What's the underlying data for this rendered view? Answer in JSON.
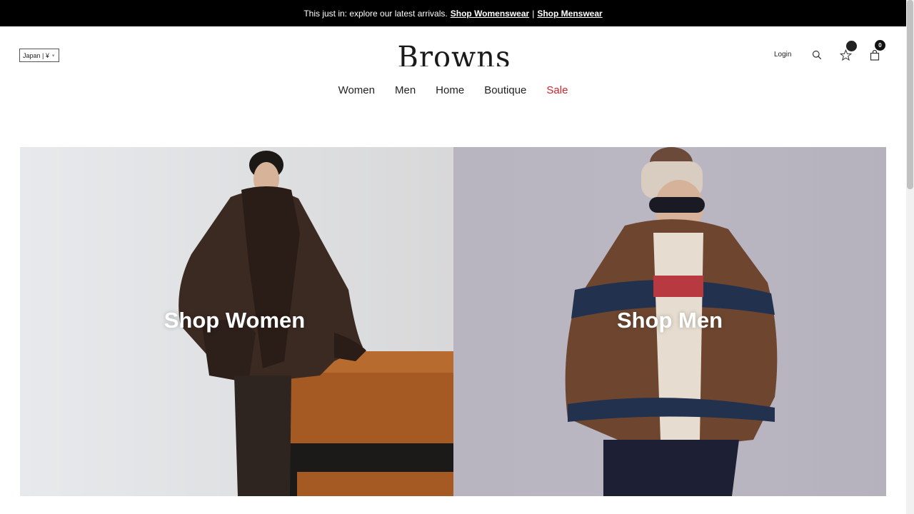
{
  "announcement": {
    "text": "This just in: explore our latest arrivals.",
    "link_women": "Shop Womenswear",
    "separator": "|",
    "link_men": "Shop Menswear"
  },
  "header": {
    "locale": "Japan | ¥",
    "logo": "Browns",
    "login": "Login",
    "bag_count": "0"
  },
  "nav": {
    "items": [
      "Women",
      "Men",
      "Home",
      "Boutique",
      "Sale"
    ]
  },
  "hero": {
    "women_label": "Shop Women",
    "men_label": "Shop Men"
  },
  "icons": {
    "search": "search-icon",
    "wishlist": "star-icon",
    "bag": "bag-icon",
    "chevron": "chevron-down-icon"
  },
  "colors": {
    "announcement_bg": "#000000",
    "sale": "#d6212b",
    "men_bg": "#b8b4c0",
    "women_bg": "#e7e9ec"
  }
}
